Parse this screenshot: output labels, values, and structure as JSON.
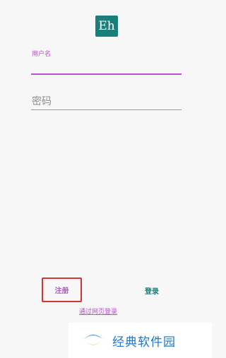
{
  "app": {
    "logo_text": "Eh"
  },
  "form": {
    "username_label": "用户名",
    "username_value": "",
    "password_placeholder": "密码",
    "password_value": ""
  },
  "actions": {
    "register_label": "注册",
    "login_label": "登录",
    "web_login_label": "通过网页登录"
  },
  "watermark": {
    "text": "经典软件园"
  },
  "colors": {
    "accent": "#b455c8",
    "brand": "#1a7e7a",
    "highlight_border": "#d8342c",
    "background": "#f6f7f6",
    "watermark_text": "#1f77c9"
  }
}
